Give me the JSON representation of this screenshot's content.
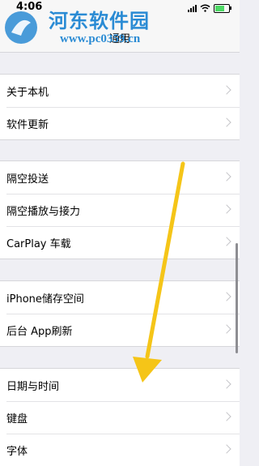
{
  "status_bar": {
    "time": "4:06"
  },
  "nav": {
    "title": "通用"
  },
  "watermark": {
    "title": "河东软件园",
    "url": "www.pc0359.cn"
  },
  "groups": [
    {
      "items": [
        {
          "label": "关于本机"
        },
        {
          "label": "软件更新"
        }
      ]
    },
    {
      "items": [
        {
          "label": "隔空投送"
        },
        {
          "label": "隔空播放与接力"
        },
        {
          "label": "CarPlay 车载"
        }
      ]
    },
    {
      "items": [
        {
          "label": "iPhone储存空间"
        },
        {
          "label": "后台 App刷新"
        }
      ]
    },
    {
      "items": [
        {
          "label": "日期与时间"
        },
        {
          "label": "键盘"
        },
        {
          "label": "字体"
        }
      ]
    }
  ],
  "colors": {
    "arrow": "#f5c518",
    "accent": "#4cd964",
    "watermark": "#2a8bd4"
  }
}
